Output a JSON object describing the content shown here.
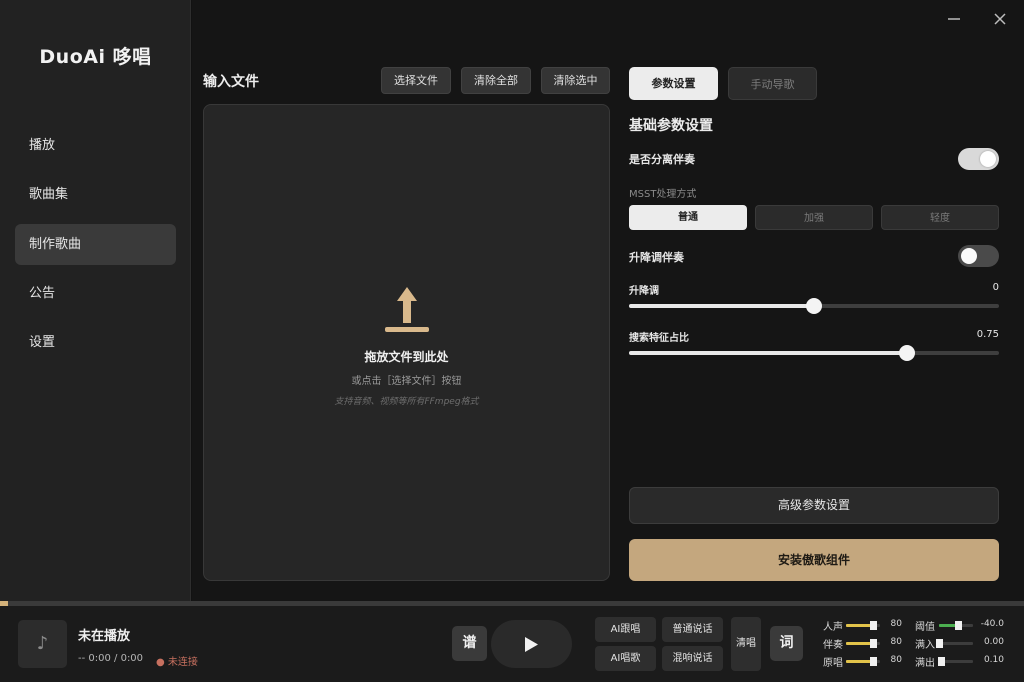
{
  "app": {
    "title": "DuoAi 哆唱"
  },
  "sidebar": {
    "items": [
      {
        "label": "播放",
        "active": false
      },
      {
        "label": "歌曲集",
        "active": false
      },
      {
        "label": "制作歌曲",
        "active": true
      },
      {
        "label": "公告",
        "active": false
      },
      {
        "label": "设置",
        "active": false
      }
    ]
  },
  "window": {
    "minimize_icon": "minimize-icon",
    "close_icon": "close-icon"
  },
  "input_panel": {
    "title": "输入文件",
    "select_file": "选择文件",
    "clear_all": "清除全部",
    "clear_selected": "清除选中",
    "dropzone": {
      "icon": "upload-icon",
      "main": "拖放文件到此处",
      "sub": "或点击［选择文件］按钮",
      "hint": "支持音频、视频等所有FFmpeg格式"
    }
  },
  "settings": {
    "tabs": [
      {
        "label": "参数设置",
        "active": true
      },
      {
        "label": "手动导歌",
        "active": false
      }
    ],
    "heading": "基础参数设置",
    "separate_accompaniment": {
      "label": "是否分离伴奏",
      "on": true
    },
    "msst": {
      "label": "MSST处理方式",
      "options": [
        "普通",
        "加强",
        "轻度"
      ],
      "selected": "普通"
    },
    "pitch_shift_accompaniment": {
      "label": "升降调伴奏",
      "on": false
    },
    "pitch": {
      "label": "升降调",
      "value": "0",
      "fraction": 0.5
    },
    "feature_ratio": {
      "label": "搜索特征占比",
      "value": "0.75",
      "fraction": 0.75
    },
    "advanced_button": "高级参数设置",
    "install_button": "安装傲歌组件"
  },
  "player": {
    "progress": 0.008,
    "album_icon": "music-note-icon",
    "title": "未在播放",
    "time": "--   0:00 / 0:00",
    "status": "● 未连接",
    "score_button": "谱",
    "play_icon": "play-icon",
    "func_buttons": [
      "AI跟唱",
      "普通说话",
      "AI唱歌",
      "混响说话"
    ],
    "clear_vocal": "清唱",
    "lyrics_button": "词",
    "mixer_left": [
      {
        "label": "人声",
        "value": "80",
        "fraction": 0.8,
        "color": "#e2c34a"
      },
      {
        "label": "伴奏",
        "value": "80",
        "fraction": 0.8,
        "color": "#e2c34a"
      },
      {
        "label": "原唱",
        "value": "80",
        "fraction": 0.8,
        "color": "#e2c34a"
      }
    ],
    "mixer_right": [
      {
        "label": "阈值",
        "value": "-40.0",
        "fraction": 0.55,
        "color": "#4caf50"
      },
      {
        "label": "满入",
        "value": "0.00",
        "fraction": 0.0,
        "color": "#e2c34a"
      },
      {
        "label": "满出",
        "value": "0.10",
        "fraction": 0.05,
        "color": "#e2c34a"
      }
    ]
  }
}
